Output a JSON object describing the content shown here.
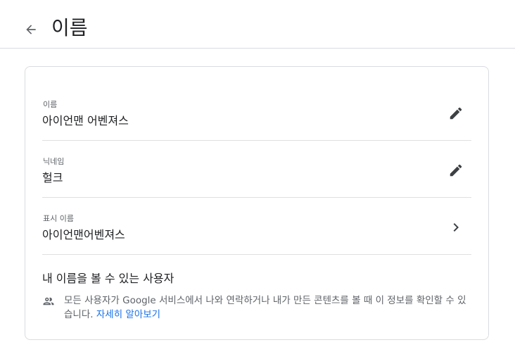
{
  "header": {
    "back_icon": "arrow-left-icon",
    "title": "이름"
  },
  "rows": [
    {
      "label": "이름",
      "value": "아이언맨 어벤져스",
      "action_icon": "pencil-icon"
    },
    {
      "label": "닉네임",
      "value": "헐크",
      "action_icon": "pencil-icon"
    },
    {
      "label": "표시 이름",
      "value": "아이언맨어벤져스",
      "action_icon": "chevron-right-icon"
    }
  ],
  "visibility": {
    "title": "내 이름을 볼 수 있는 사용자",
    "icon": "people-icon",
    "description": "모든 사용자가 Google 서비스에서 나와 연락하거나 내가 만든 콘텐츠를 볼 때 이 정보를 확인할 수 있습니다.",
    "learn_more": "자세히 알아보기"
  },
  "colors": {
    "link": "#1a73e8",
    "text_primary": "#202124",
    "text_secondary": "#5f6368",
    "border": "#dadce0"
  }
}
